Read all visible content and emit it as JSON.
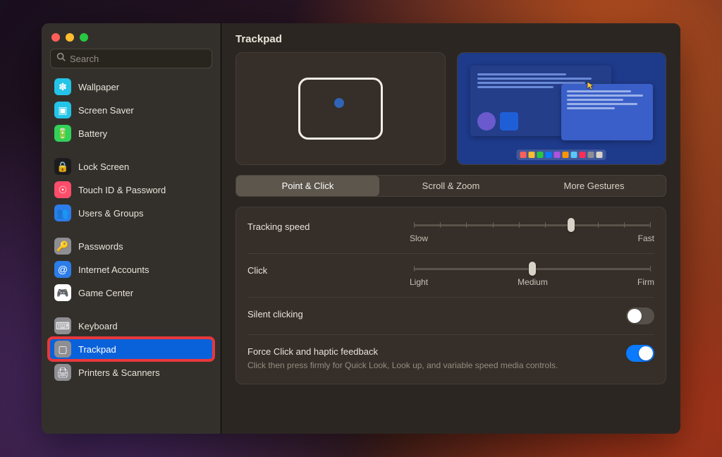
{
  "window": {
    "title": "Trackpad"
  },
  "search": {
    "placeholder": "Search"
  },
  "sidebar": {
    "groups": [
      [
        {
          "id": "wallpaper",
          "label": "Wallpaper",
          "color": "#24c3e8",
          "glyph": "✽"
        },
        {
          "id": "screensaver",
          "label": "Screen Saver",
          "color": "#24c3e8",
          "glyph": "▣"
        },
        {
          "id": "battery",
          "label": "Battery",
          "color": "#32d158",
          "glyph": "🔋"
        }
      ],
      [
        {
          "id": "lockscreen",
          "label": "Lock Screen",
          "color": "#1c1c1e",
          "glyph": "🔒"
        },
        {
          "id": "touchid",
          "label": "Touch ID & Password",
          "color": "#ff4d6a",
          "glyph": "☉"
        },
        {
          "id": "users",
          "label": "Users & Groups",
          "color": "#2b7de9",
          "glyph": "👥"
        }
      ],
      [
        {
          "id": "passwords",
          "label": "Passwords",
          "color": "#8e8e93",
          "glyph": "🔑"
        },
        {
          "id": "internet",
          "label": "Internet Accounts",
          "color": "#2b7de9",
          "glyph": "@"
        },
        {
          "id": "gamecenter",
          "label": "Game Center",
          "color": "#ffffff",
          "glyph": "🎮"
        }
      ],
      [
        {
          "id": "keyboard",
          "label": "Keyboard",
          "color": "#8e8e93",
          "glyph": "⌨"
        },
        {
          "id": "trackpad",
          "label": "Trackpad",
          "color": "#8e8e93",
          "glyph": "▢",
          "selected": true,
          "highlighted": true
        },
        {
          "id": "printers",
          "label": "Printers & Scanners",
          "color": "#8e8e93",
          "glyph": "🖨"
        }
      ]
    ]
  },
  "tabs": [
    {
      "id": "pointclick",
      "label": "Point & Click",
      "active": true
    },
    {
      "id": "scrollzoom",
      "label": "Scroll & Zoom"
    },
    {
      "id": "moregestures",
      "label": "More Gestures"
    }
  ],
  "settings": {
    "tracking": {
      "label": "Tracking speed",
      "min_label": "Slow",
      "max_label": "Fast",
      "ticks": 10,
      "value": 6
    },
    "click": {
      "label": "Click",
      "min_label": "Light",
      "mid_label": "Medium",
      "max_label": "Firm",
      "ticks": 3,
      "value": 1
    },
    "silent": {
      "label": "Silent clicking",
      "on": false
    },
    "force": {
      "label": "Force Click and haptic feedback",
      "desc": "Click then press firmly for Quick Look, Look up, and variable speed media controls.",
      "on": true
    }
  },
  "dock_colors": [
    "#ff5f57",
    "#febc2e",
    "#28c840",
    "#0a7aff",
    "#af52de",
    "#ff9500",
    "#5ac8fa",
    "#ff2d55",
    "#8e8e93",
    "#d8d3c8"
  ]
}
